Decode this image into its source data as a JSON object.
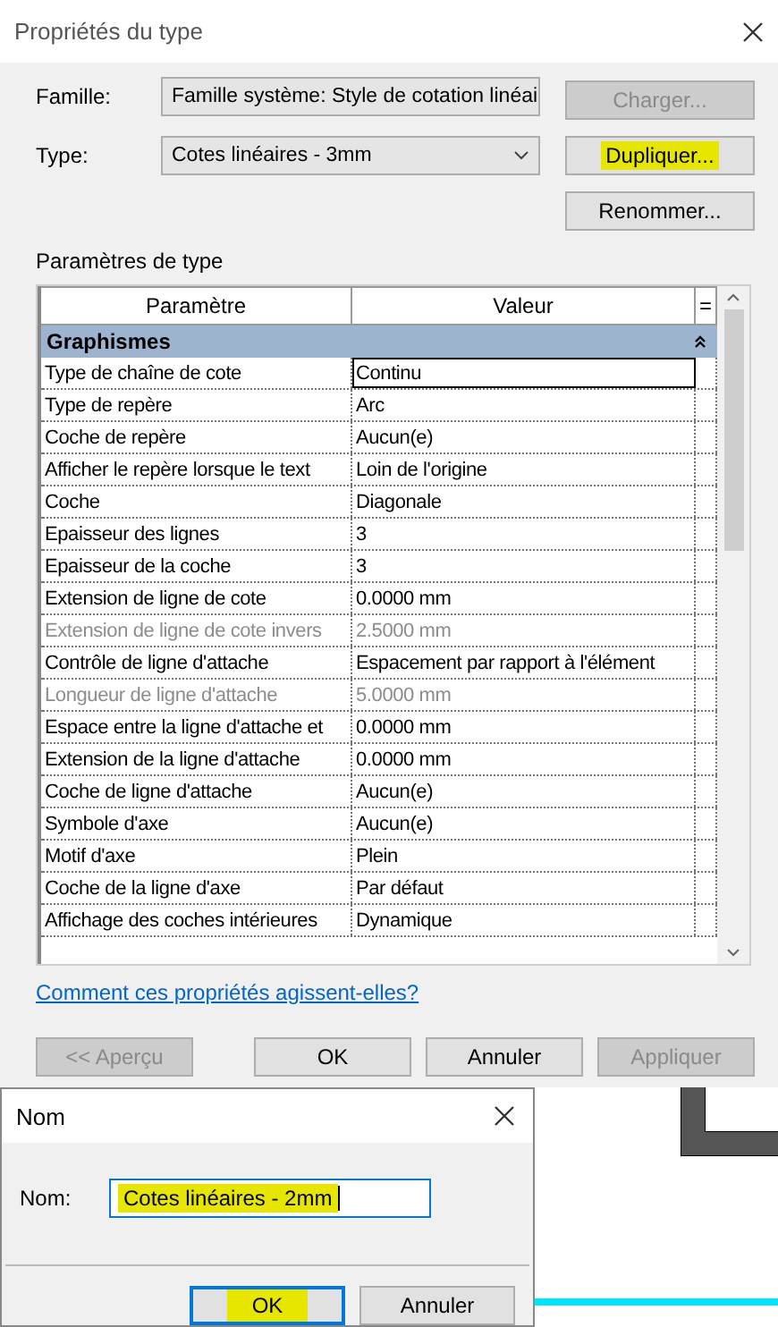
{
  "window": {
    "title": "Propriétés du type"
  },
  "family": {
    "label": "Famille:",
    "value": "Famille système: Style de cotation linéai"
  },
  "type": {
    "label": "Type:",
    "value": "Cotes linéaires - 3mm"
  },
  "side_buttons": [
    {
      "label": "Charger...",
      "disabled": true,
      "highlighted": false
    },
    {
      "label": "Dupliquer...",
      "disabled": false,
      "highlighted": true
    },
    {
      "label": "Renommer...",
      "disabled": false,
      "highlighted": false
    }
  ],
  "section_label": "Paramètres de type",
  "table": {
    "columns": [
      "Paramètre",
      "Valeur",
      "="
    ],
    "group": {
      "label": "Graphismes",
      "expanded": true
    },
    "rows": [
      {
        "param": "Type de chaîne de cote",
        "value": "Continu",
        "disabled": false,
        "selected": true
      },
      {
        "param": "Type de repère",
        "value": "Arc",
        "disabled": false,
        "selected": false
      },
      {
        "param": "Coche de repère",
        "value": "Aucun(e)",
        "disabled": false,
        "selected": false
      },
      {
        "param": "Afficher le repère lorsque le text",
        "value": "Loin de l'origine",
        "disabled": false,
        "selected": false
      },
      {
        "param": "Coche",
        "value": "Diagonale",
        "disabled": false,
        "selected": false
      },
      {
        "param": "Epaisseur des lignes",
        "value": "3",
        "disabled": false,
        "selected": false
      },
      {
        "param": "Epaisseur de la coche",
        "value": "3",
        "disabled": false,
        "selected": false
      },
      {
        "param": "Extension de ligne de cote",
        "value": "0.0000 mm",
        "disabled": false,
        "selected": false
      },
      {
        "param": "Extension de ligne de cote invers",
        "value": "2.5000 mm",
        "disabled": true,
        "selected": false
      },
      {
        "param": "Contrôle de ligne d'attache",
        "value": "Espacement par rapport à l'élément",
        "disabled": false,
        "selected": false
      },
      {
        "param": "Longueur de ligne d'attache",
        "value": "5.0000 mm",
        "disabled": true,
        "selected": false
      },
      {
        "param": "Espace entre la ligne d'attache et",
        "value": "0.0000 mm",
        "disabled": false,
        "selected": false
      },
      {
        "param": "Extension de la ligne d'attache",
        "value": "0.0000 mm",
        "disabled": false,
        "selected": false
      },
      {
        "param": "Coche de ligne d'attache",
        "value": "Aucun(e)",
        "disabled": false,
        "selected": false
      },
      {
        "param": "Symbole d'axe",
        "value": "Aucun(e)",
        "disabled": false,
        "selected": false
      },
      {
        "param": "Motif d'axe",
        "value": "Plein",
        "disabled": false,
        "selected": false
      },
      {
        "param": "Coche de la ligne d'axe",
        "value": "Par défaut",
        "disabled": false,
        "selected": false
      },
      {
        "param": "Affichage des coches intérieures",
        "value": "Dynamique",
        "disabled": false,
        "selected": false
      }
    ]
  },
  "help_link": "Comment ces propriétés agissent-elles?",
  "footer_buttons": [
    {
      "label": "<< Aperçu",
      "disabled": true
    },
    {
      "label": "OK",
      "disabled": false
    },
    {
      "label": "Annuler",
      "disabled": false
    },
    {
      "label": "Appliquer",
      "disabled": true
    }
  ],
  "name_dialog": {
    "title": "Nom",
    "label": "Nom:",
    "value": "Cotes linéaires - 2mm",
    "value_highlighted": true,
    "buttons": [
      {
        "label": "OK",
        "focused": true,
        "highlighted": true
      },
      {
        "label": "Annuler",
        "focused": false,
        "highlighted": false
      }
    ]
  }
}
